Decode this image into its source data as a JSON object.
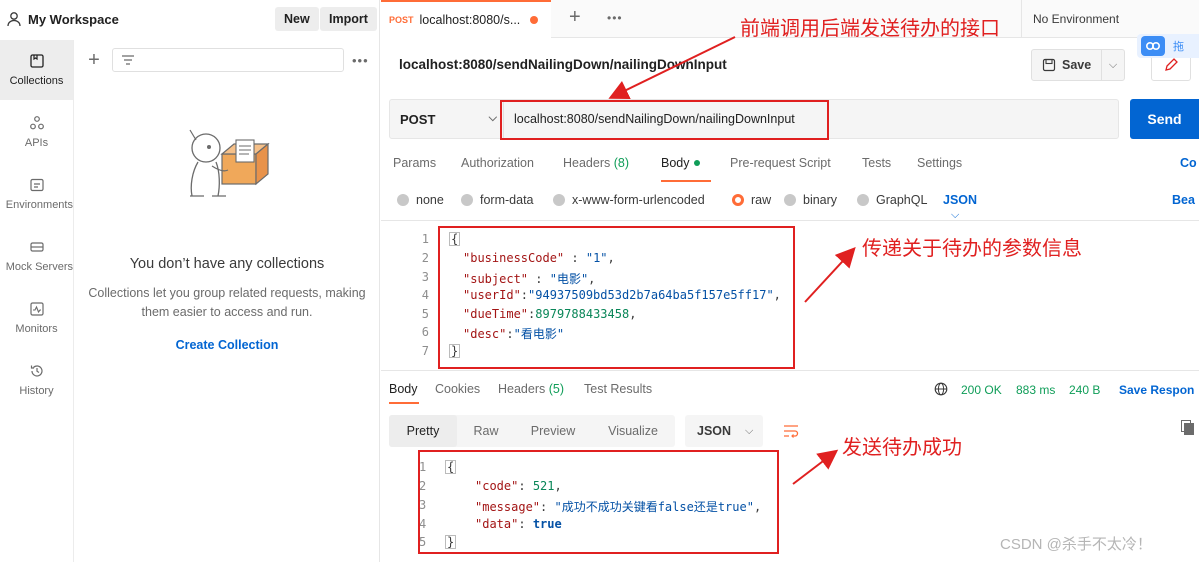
{
  "workspace": {
    "title": "My Workspace",
    "new_label": "New",
    "import_label": "Import"
  },
  "rail": {
    "items": [
      {
        "label": "Collections",
        "icon": "collections-icon"
      },
      {
        "label": "APIs",
        "icon": "apis-icon"
      },
      {
        "label": "Environments",
        "icon": "environments-icon"
      },
      {
        "label": "Mock Servers",
        "icon": "mock-servers-icon"
      },
      {
        "label": "Monitors",
        "icon": "monitors-icon"
      },
      {
        "label": "History",
        "icon": "history-icon"
      }
    ]
  },
  "collections": {
    "empty_title": "You don’t have any collections",
    "empty_desc": "Collections let you group related requests, making them easier to access and run.",
    "create_label": "Create Collection"
  },
  "tabbar": {
    "tab_method": "POST",
    "tab_name": "localhost:8080/s...",
    "environment": "No Environment"
  },
  "request": {
    "name": "localhost:8080/sendNailingDown/nailingDownInput",
    "save_label": "Save",
    "method": "POST",
    "url": "localhost:8080/sendNailingDown/nailingDownInput",
    "send_label": "Send",
    "tabs": {
      "params": "Params",
      "authorization": "Authorization",
      "headers": "Headers",
      "headers_count": "(8)",
      "body": "Body",
      "prerequest": "Pre-request Script",
      "tests": "Tests",
      "settings": "Settings",
      "cookies_cut": "Co"
    },
    "body_types": {
      "none": "none",
      "form_data": "form-data",
      "urlencoded": "x-www-form-urlencoded",
      "raw": "raw",
      "binary": "binary",
      "graphql": "GraphQL",
      "format": "JSON",
      "beautify_cut": "Bea"
    },
    "body_lines": [
      {
        "n": "1",
        "text": "{"
      },
      {
        "n": "2",
        "key": "\"businessCode\"",
        "sep": " : ",
        "val": "\"1\"",
        "end": ","
      },
      {
        "n": "3",
        "key": "\"subject\"",
        "sep": " : ",
        "val": "\"电影\"",
        "end": ","
      },
      {
        "n": "4",
        "key": "\"userId\"",
        "sep": ":",
        "val": "\"94937509bd53d2b7a64ba5f157e5ff17\"",
        "end": ","
      },
      {
        "n": "5",
        "key": "\"dueTime\"",
        "sep": ":",
        "val": "8979788433458",
        "end": ","
      },
      {
        "n": "6",
        "key": "\"desc\"",
        "sep": ":",
        "val": "\"看电影\"",
        "end": ""
      },
      {
        "n": "7",
        "text": "}"
      }
    ]
  },
  "response": {
    "tabs": {
      "body": "Body",
      "cookies": "Cookies",
      "headers": "Headers",
      "headers_count": "(5)",
      "test_results": "Test Results"
    },
    "status": "200 OK",
    "time": "883 ms",
    "size": "240 B",
    "save_label": "Save Respon",
    "views": {
      "pretty": "Pretty",
      "raw": "Raw",
      "preview": "Preview",
      "visualize": "Visualize"
    },
    "format": "JSON",
    "lines": [
      {
        "n": "1",
        "text": "{"
      },
      {
        "n": "2",
        "key": "\"code\"",
        "val": "521",
        "end": ","
      },
      {
        "n": "3",
        "key": "\"message\"",
        "val": "\"成功不成功关键看false还是true\"",
        "end": ","
      },
      {
        "n": "4",
        "key": "\"data\"",
        "val": "true",
        "end": ""
      },
      {
        "n": "5",
        "text": "}"
      }
    ]
  },
  "annotations": {
    "top": "前端调用后端发送待办的接口",
    "middle": "传递关于待办的参数信息",
    "bottom": "发送待办成功",
    "color": "#e02020"
  },
  "cloud_badge_text": "拖",
  "watermark": "CSDN @杀手不太冷！",
  "colors": {
    "accent": "#ff6c37",
    "primary": "#0265d2",
    "success": "#0f9d58"
  }
}
